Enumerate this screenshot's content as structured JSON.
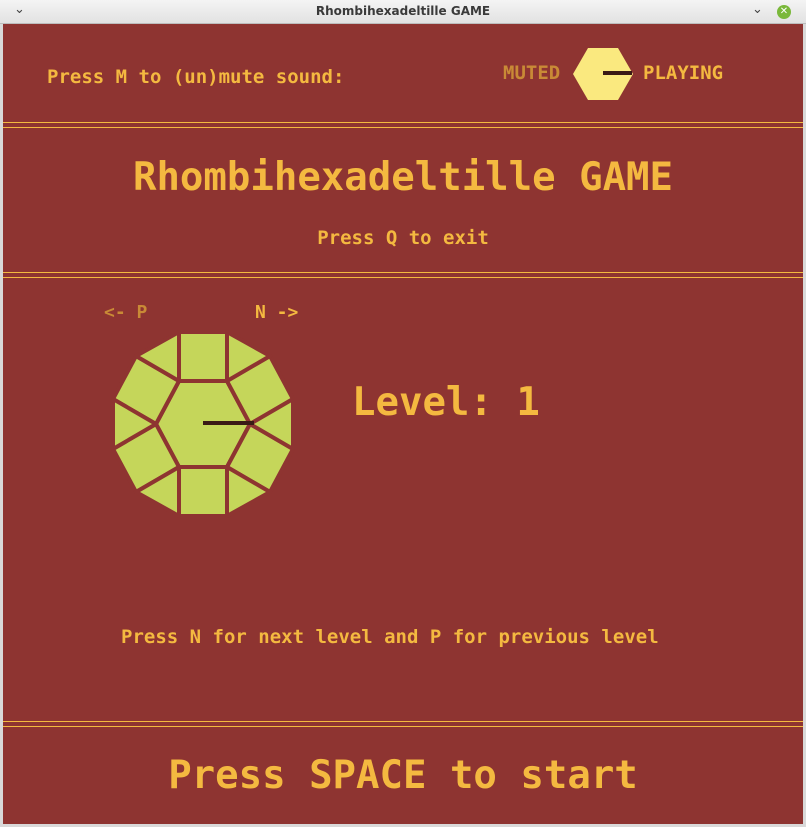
{
  "window": {
    "title": "Rhombihexadeltille GAME",
    "menu_glyph": "⌄",
    "minimize_glyph": "⌄",
    "close_glyph": "✕"
  },
  "sound": {
    "prompt": "Press M to (un)mute sound:",
    "muted_label": "MUTED",
    "playing_label": "PLAYING",
    "state": "PLAYING"
  },
  "header": {
    "title": "Rhombihexadeltille GAME",
    "exit_hint": "Press Q to exit"
  },
  "level_select": {
    "prev_label": "<- P",
    "next_label": "N ->",
    "level_text": "Level: 1",
    "hint": "Press N for next level and P for previous level"
  },
  "footer": {
    "start_hint": "Press SPACE to start"
  },
  "colors": {
    "background": "#8e3431",
    "accent": "#f4b940",
    "tile": "#c5d65a",
    "toggle": "#fae97f",
    "pointer": "#3a1a16"
  }
}
